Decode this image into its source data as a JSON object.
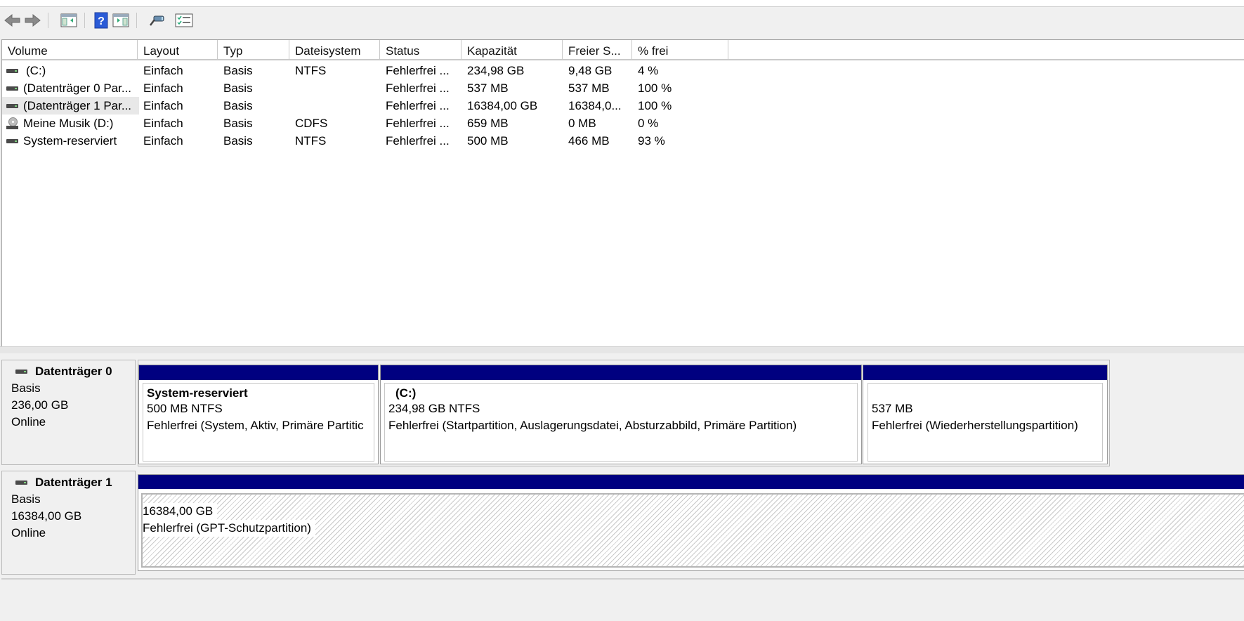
{
  "toolbar": {
    "buttons": [
      {
        "icon": "back-arrow-icon"
      },
      {
        "icon": "forward-arrow-icon"
      },
      {
        "icon": "show-hide-console-tree-icon"
      },
      {
        "icon": "help-icon"
      },
      {
        "icon": "show-hide-action-pane-icon"
      },
      {
        "icon": "connect-key-icon"
      },
      {
        "icon": "properties-list-icon"
      }
    ]
  },
  "volume_list": {
    "columns": [
      "Volume",
      "Layout",
      "Typ",
      "Dateisystem",
      "Status",
      "Kapazität",
      "Freier S...",
      "% frei"
    ],
    "rows": [
      {
        "icon": "drive",
        "cells": [
          "(C:)",
          "Einfach",
          "Basis",
          "NTFS",
          "Fehlerfrei ...",
          "234,98 GB",
          "9,48 GB",
          "4 %"
        ]
      },
      {
        "icon": "drive",
        "cells": [
          "(Datenträger 0 Par...",
          "Einfach",
          "Basis",
          "",
          "Fehlerfrei ...",
          "537 MB",
          "537 MB",
          "100 %"
        ]
      },
      {
        "icon": "drive",
        "cells": [
          "(Datenträger 1 Par...",
          "Einfach",
          "Basis",
          "",
          "Fehlerfrei ...",
          "16384,00 GB",
          "16384,0...",
          "100 %"
        ]
      },
      {
        "icon": "cd",
        "cells": [
          "Meine Musik (D:)",
          "Einfach",
          "Basis",
          "CDFS",
          "Fehlerfrei ...",
          "659 MB",
          "0 MB",
          "0 %"
        ]
      },
      {
        "icon": "drive",
        "cells": [
          "System-reserviert",
          "Einfach",
          "Basis",
          "NTFS",
          "Fehlerfrei ...",
          "500 MB",
          "466 MB",
          "93 %"
        ]
      }
    ]
  },
  "disks": [
    {
      "name": "Datenträger 0",
      "type": "Basis",
      "size": "236,00 GB",
      "state": "Online",
      "partitions": [
        {
          "title": "System-reserviert",
          "size_fs": "500 MB NTFS",
          "status": "Fehlerfrei (System, Aktiv, Primäre Partitic"
        },
        {
          "title": "(C:)",
          "size_fs": "234,98 GB NTFS",
          "status": "Fehlerfrei (Startpartition, Auslagerungsdatei, Absturzabbild, Primäre Partition)"
        },
        {
          "title": "",
          "size_fs": "537 MB",
          "status": "Fehlerfrei (Wiederherstellungspartition)"
        }
      ]
    },
    {
      "name": "Datenträger 1",
      "type": "Basis",
      "size": "16384,00 GB",
      "state": "Online",
      "partitions": [
        {
          "title": "",
          "size_fs": "16384,00 GB",
          "status": "Fehlerfrei (GPT-Schutzpartition)"
        }
      ]
    }
  ],
  "colors": {
    "partition_bar": "#000080",
    "background": "#f0f0f0"
  }
}
